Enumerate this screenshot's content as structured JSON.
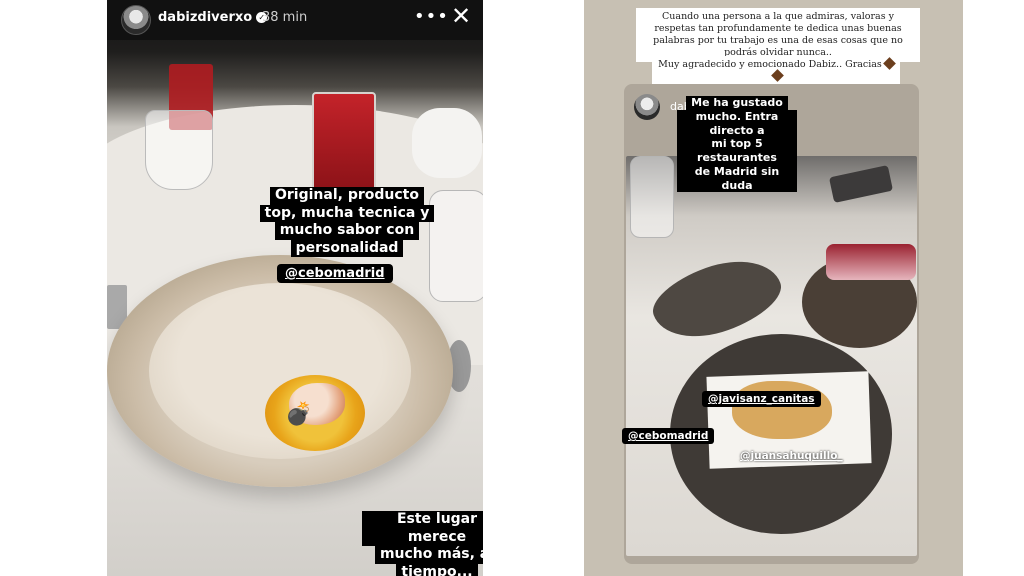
{
  "left_story": {
    "username": "dabizdiverxo",
    "time": "38 min",
    "more": "•••",
    "close": "✕",
    "caption_top": [
      "Original, producto",
      "top, mucha tecnica y",
      "mucho sabor con",
      "personalidad"
    ],
    "mention": "@cebomadrid",
    "caption_bottom": [
      "Este lugar merece",
      "mucho más, al",
      "tiempo..."
    ],
    "emoji": "💣"
  },
  "right_story": {
    "quote": "Cuando una persona a la que admiras, valoras y respetas tan profundamente te dedica unas buenas palabras por tu trabajo es una de esas cosas que no podrás olvidar nunca..",
    "thanks": "Muy agradecido y emocionado Dabiz.. Gracias",
    "repost_username": "dabizdiverxo",
    "caption": [
      "Me ha gustado",
      "mucho. Entra directo a",
      "mi top 5 restaurantes",
      "de Madrid sin duda"
    ],
    "mention1": "@javisanz_canitas",
    "mention2": "@cebomadrid",
    "mention3": "@juansahuquillo_"
  }
}
